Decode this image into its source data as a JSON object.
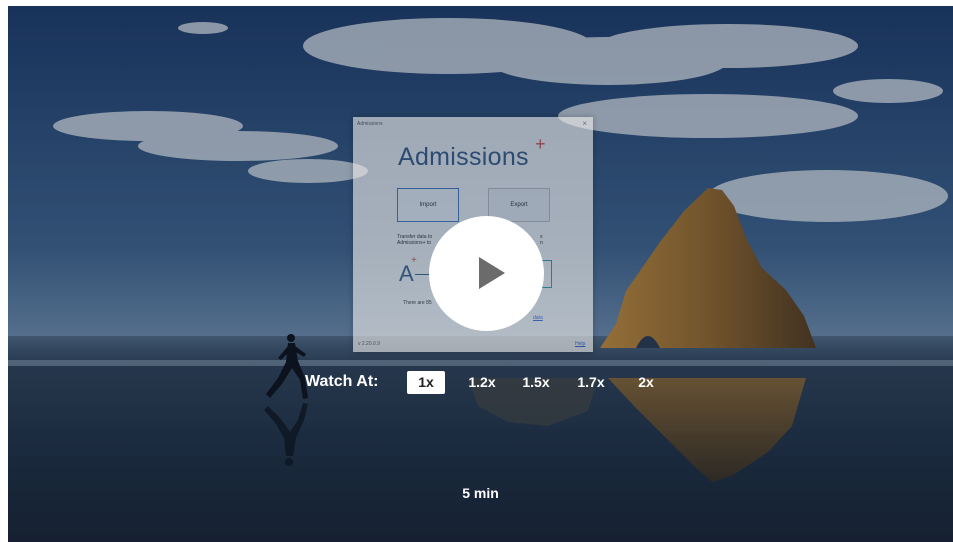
{
  "dialog": {
    "window_title": "Admissions",
    "close_glyph": "×",
    "logo_text": "Admissions",
    "logo_plus": "+",
    "import_label": "Import",
    "export_label": "Export",
    "info_text_line1": "Transfer data to",
    "info_text_line2": "Admissions+ to",
    "info_text_right1": "s",
    "info_text_right2": "n",
    "logo_small": "A",
    "logo_small_plus": "+",
    "bottom_text": "There are 85",
    "bottom_link": "data",
    "version": "v 2.20.0.9",
    "help_link": "Help"
  },
  "player": {
    "play_icon": "play-icon",
    "watch_label": "Watch At:",
    "speeds": [
      "1x",
      "1.2x",
      "1.5x",
      "1.7x",
      "2x"
    ],
    "selected_speed": "1x",
    "duration": "5 min"
  },
  "colors": {
    "speed_active_bg": "#ffffff",
    "play_button_bg": "#ffffff",
    "text": "#ffffff"
  }
}
